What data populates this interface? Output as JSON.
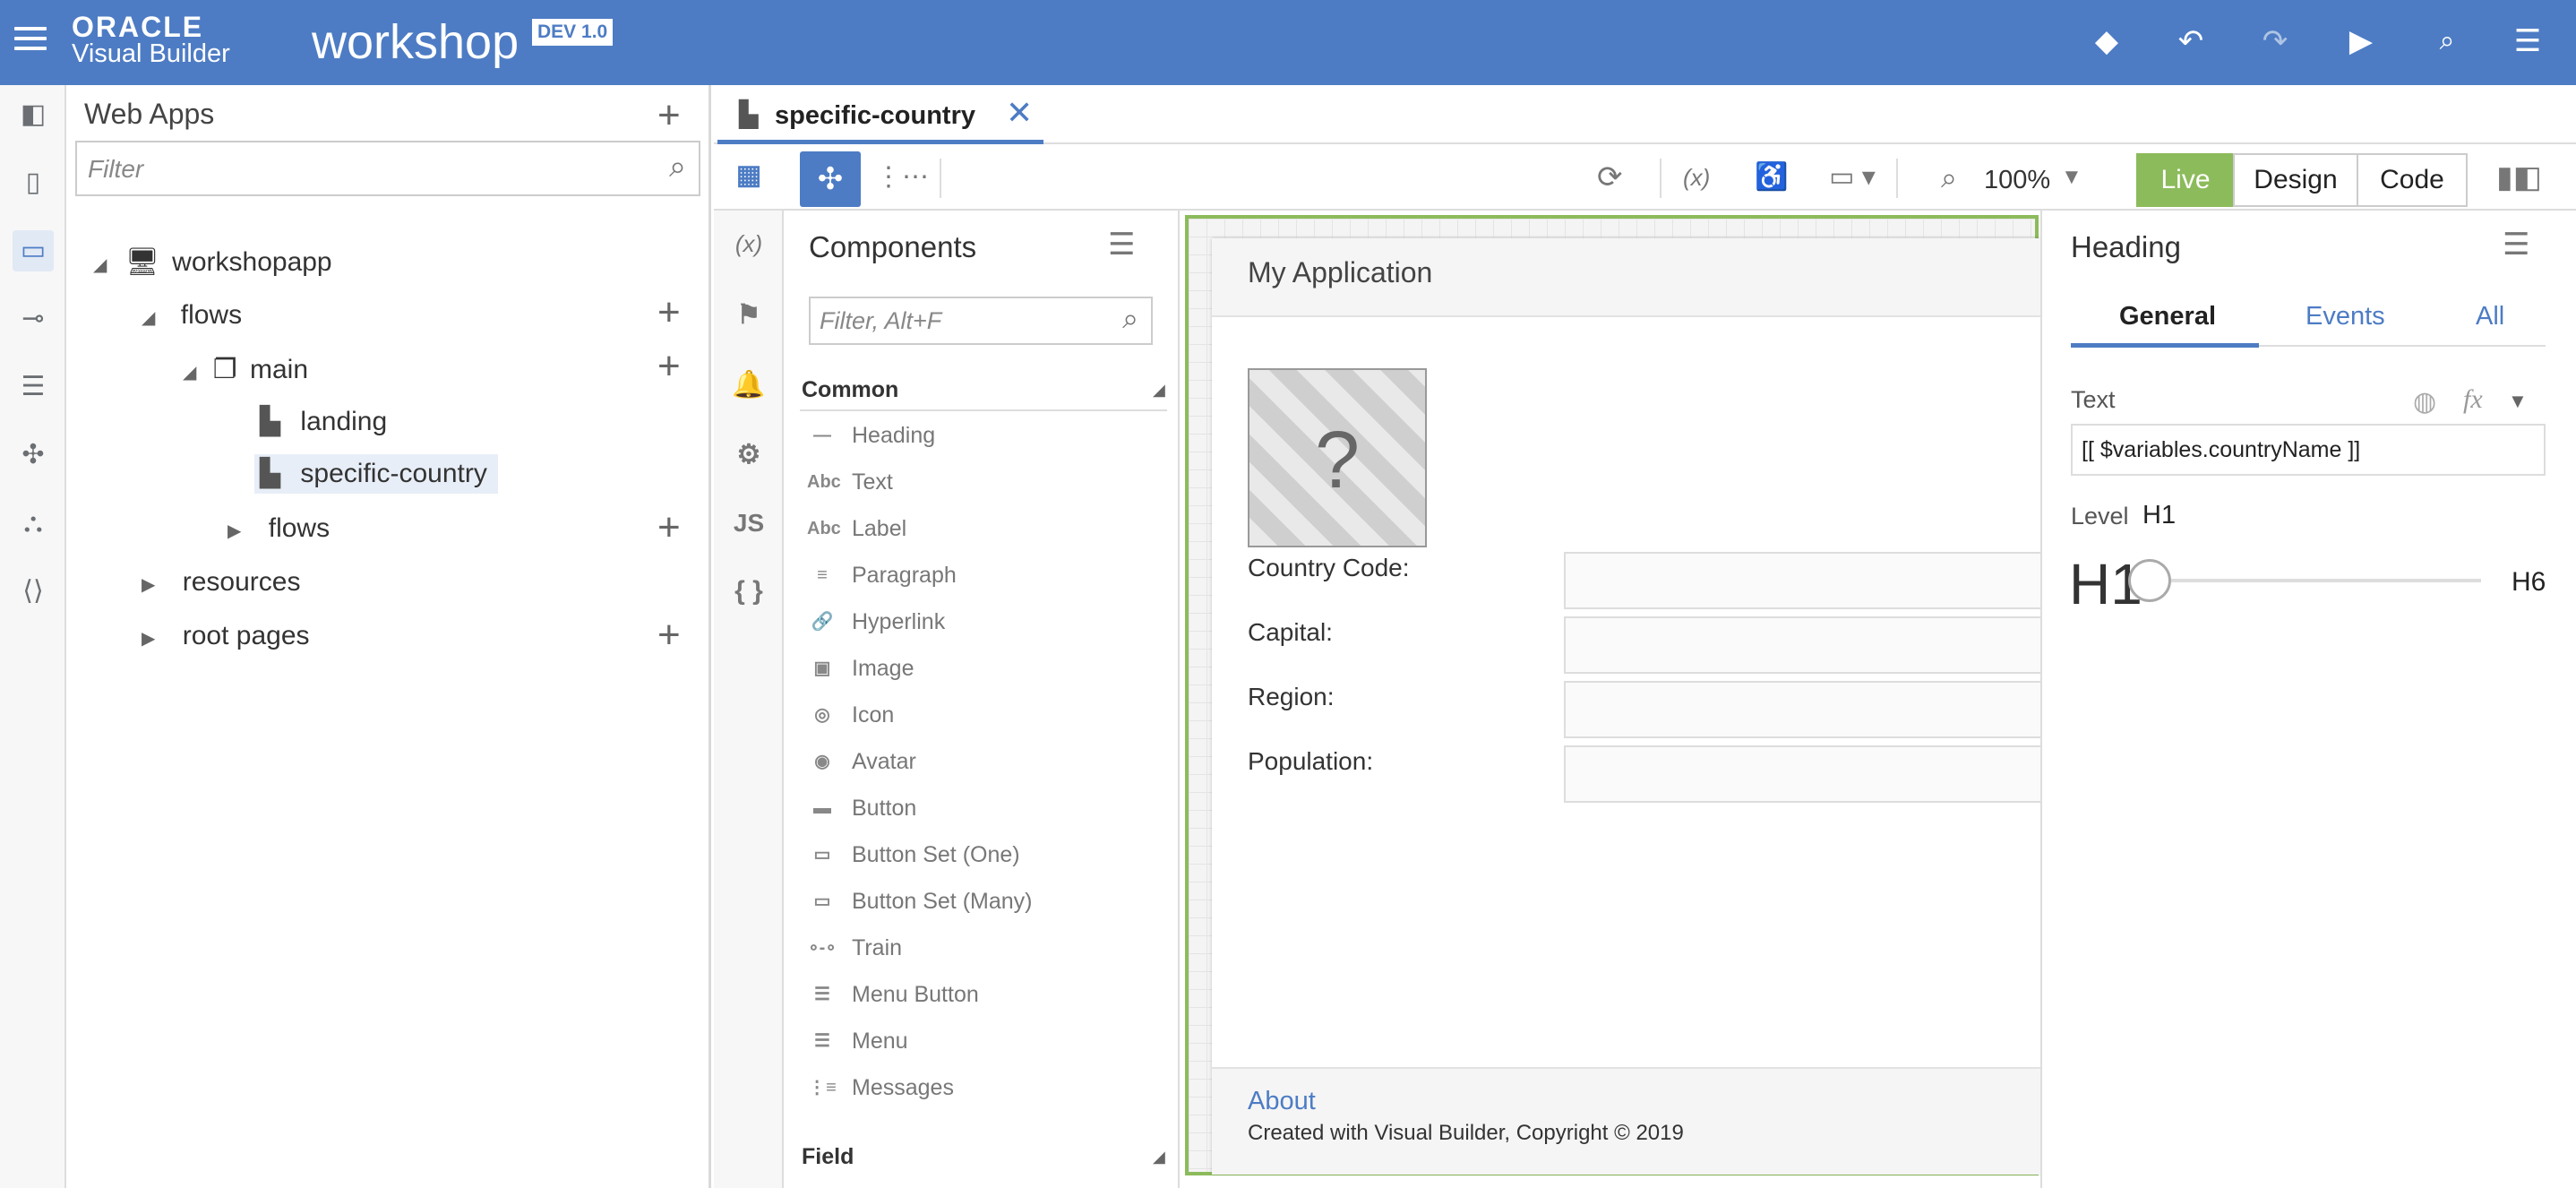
{
  "header": {
    "logo_oracle": "ORACLE",
    "logo_product": "Visual Builder",
    "app_name": "workshop",
    "dev_badge": "DEV 1.0"
  },
  "web_apps": {
    "title": "Web Apps",
    "filter_placeholder": "Filter",
    "tree": {
      "root": "workshopapp",
      "flows": "flows",
      "main": "main",
      "landing": "landing",
      "specific_country": "specific-country",
      "sub_flows": "flows",
      "resources": "resources",
      "root_pages": "root pages"
    }
  },
  "editor": {
    "tab_label": "specific-country",
    "tab_close": "✕",
    "zoom": "100%",
    "modes": [
      "Live",
      "Design",
      "Code"
    ]
  },
  "palette": {
    "title": "Components",
    "filter_placeholder": "Filter, Alt+F",
    "section_common": "Common",
    "section_field": "Field",
    "items": [
      {
        "label": "Heading",
        "icon": "heading-icon",
        "glyph": "—"
      },
      {
        "label": "Text",
        "icon": "text-icon",
        "glyph": "Abc"
      },
      {
        "label": "Label",
        "icon": "label-icon",
        "glyph": "Abc"
      },
      {
        "label": "Paragraph",
        "icon": "paragraph-icon",
        "glyph": "≡"
      },
      {
        "label": "Hyperlink",
        "icon": "hyperlink-icon",
        "glyph": "🔗"
      },
      {
        "label": "Image",
        "icon": "image-icon",
        "glyph": "▣"
      },
      {
        "label": "Icon",
        "icon": "icon-icon",
        "glyph": "◎"
      },
      {
        "label": "Avatar",
        "icon": "avatar-icon",
        "glyph": "◉"
      },
      {
        "label": "Button",
        "icon": "button-icon",
        "glyph": "▬"
      },
      {
        "label": "Button Set (One)",
        "icon": "button-set-one-icon",
        "glyph": "▭"
      },
      {
        "label": "Button Set (Many)",
        "icon": "button-set-many-icon",
        "glyph": "▭"
      },
      {
        "label": "Train",
        "icon": "train-icon",
        "glyph": "∘-∘"
      },
      {
        "label": "Menu Button",
        "icon": "menu-button-icon",
        "glyph": "☰"
      },
      {
        "label": "Menu",
        "icon": "menu-icon",
        "glyph": "☰"
      },
      {
        "label": "Messages",
        "icon": "messages-icon",
        "glyph": "⋮≡"
      }
    ]
  },
  "canvas": {
    "app_title": "My Application",
    "image_placeholder": "?",
    "fields": [
      "Country Code:",
      "Capital:",
      "Region:",
      "Population:"
    ],
    "footer_link": "About",
    "footer_text": "Created with Visual Builder, Copyright © 2019"
  },
  "properties": {
    "title": "Heading",
    "tabs": [
      "General",
      "Events",
      "All"
    ],
    "text_label": "Text",
    "text_value": "[[ $variables.countryName ]]",
    "level_label": "Level",
    "level_value": "H1",
    "slider_min": "H1",
    "slider_max": "H6",
    "slider_position": 0
  },
  "colors": {
    "header_bg": "#4d7cc4",
    "live_green": "#8cbb5b",
    "link_blue": "#4d7cc4"
  }
}
